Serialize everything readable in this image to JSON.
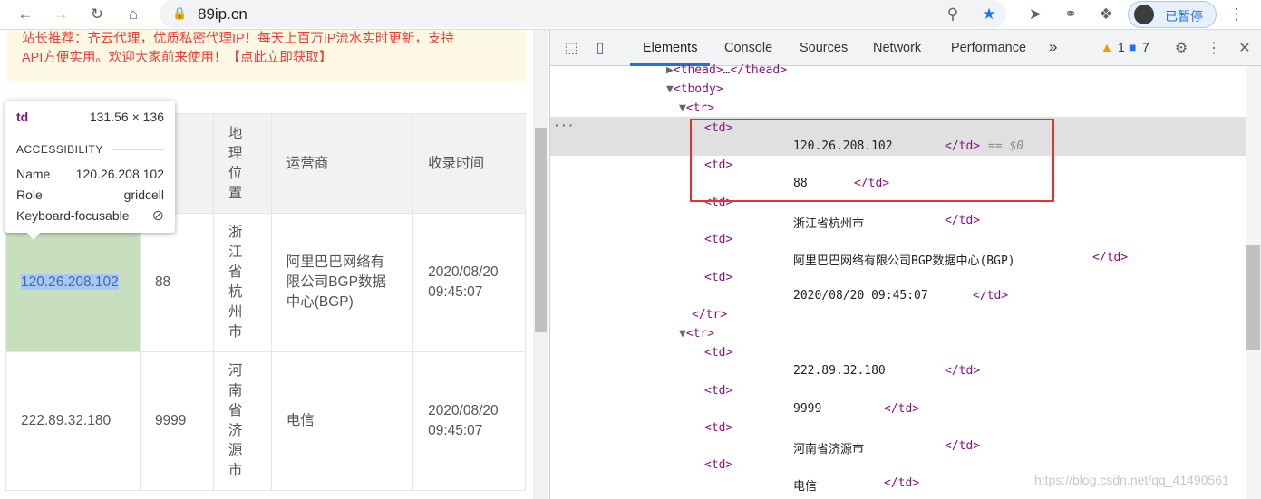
{
  "browser": {
    "url": "89ip.cn",
    "profile_label": "已暂停"
  },
  "page": {
    "notice_line1": "站长推荐：齐云代理，优质私密代理IP！每天上百万IP流水实时更新，支持",
    "notice_line2": "API方便实用。欢迎大家前来使用！【点此立即获取】",
    "table": {
      "headers": [
        "",
        "口",
        "地理位置",
        "运营商",
        "收录时间"
      ],
      "rows": [
        {
          "ip": "120.26.208.102",
          "port": "88",
          "location": "浙江省杭州市",
          "isp": "阿里巴巴网络有限公司BGP数据中心(BGP)",
          "time_date": "2020/08/20",
          "time_clock": "09:45:07"
        },
        {
          "ip": "222.89.32.180",
          "port": "9999",
          "location": "河南省济源市",
          "isp": "电信",
          "time_date": "2020/08/20",
          "time_clock": "09:45:07"
        }
      ]
    },
    "tooltip": {
      "tag": "td",
      "size": "131.56 × 136",
      "section": "ACCESSIBILITY",
      "name_label": "Name",
      "name_value": "120.26.208.102",
      "role_label": "Role",
      "role_value": "gridcell",
      "focus_label": "Keyboard-focusable"
    }
  },
  "devtools": {
    "tabs": [
      "Elements",
      "Console",
      "Sources",
      "Network",
      "Performance"
    ],
    "more": "»",
    "warnings": "1",
    "messages": "7",
    "dom_lines": [
      {
        "open": "▶",
        "tag": "<thead>",
        "mid": "…",
        "close": "</thead>"
      },
      {
        "open": "▼",
        "tag": "<tbody>"
      },
      {
        "open": "▼",
        "tag": "<tr>"
      },
      {
        "tag": "<td>"
      },
      {
        "text": "120.26.208.102",
        "close": "</td>",
        "suffix": "== $0"
      },
      {
        "tag": "<td>"
      },
      {
        "text": "88",
        "close": "</td>"
      },
      {
        "tag": "<td>"
      },
      {
        "text": "浙江省杭州市",
        "close": "</td>"
      },
      {
        "tag": "<td>"
      },
      {
        "text": "阿里巴巴网络有限公司BGP数据中心(BGP)",
        "close": "</td>"
      },
      {
        "tag": "<td>"
      },
      {
        "text": "2020/08/20 09:45:07",
        "close": "</td>"
      },
      {
        "tag": "</tr>"
      },
      {
        "open": "▼",
        "tag": "<tr>"
      },
      {
        "tag": "<td>"
      },
      {
        "text": "222.89.32.180",
        "close": "</td>"
      },
      {
        "tag": "<td>"
      },
      {
        "text": "9999",
        "close": "</td>"
      },
      {
        "tag": "<td>"
      },
      {
        "text": "河南省济源市",
        "close": "</td>"
      },
      {
        "tag": "<td>"
      },
      {
        "text": "电信",
        "close": "</td>"
      }
    ]
  },
  "watermark": "https://blog.csdn.net/qq_41490561"
}
